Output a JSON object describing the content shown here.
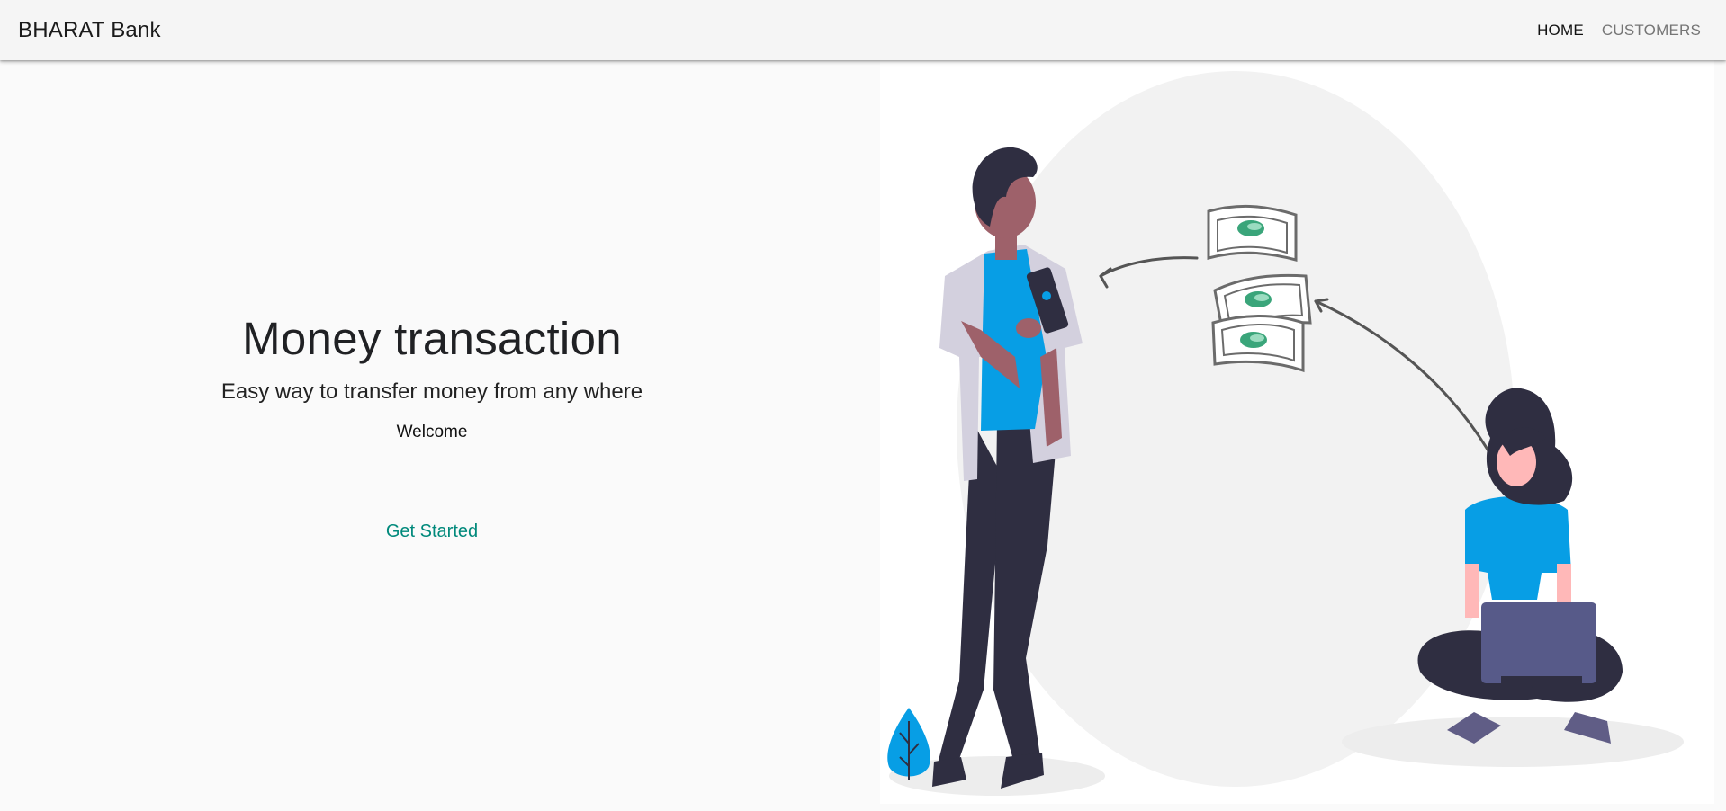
{
  "navbar": {
    "brand": "BHARAT Bank",
    "links": [
      {
        "label": "HOME",
        "active": true
      },
      {
        "label": "CUSTOMERS",
        "active": false
      }
    ]
  },
  "hero": {
    "title": "Money transaction",
    "subtitle": "Easy way to transfer money from any where",
    "welcome": "Welcome",
    "cta_label": "Get Started",
    "cta_color": "#00897b"
  },
  "illustration": {
    "name": "money-transfer-illustration",
    "accent_color": "#079ee5",
    "dark_color": "#2f2e41",
    "money_color": "#3aa57a"
  }
}
